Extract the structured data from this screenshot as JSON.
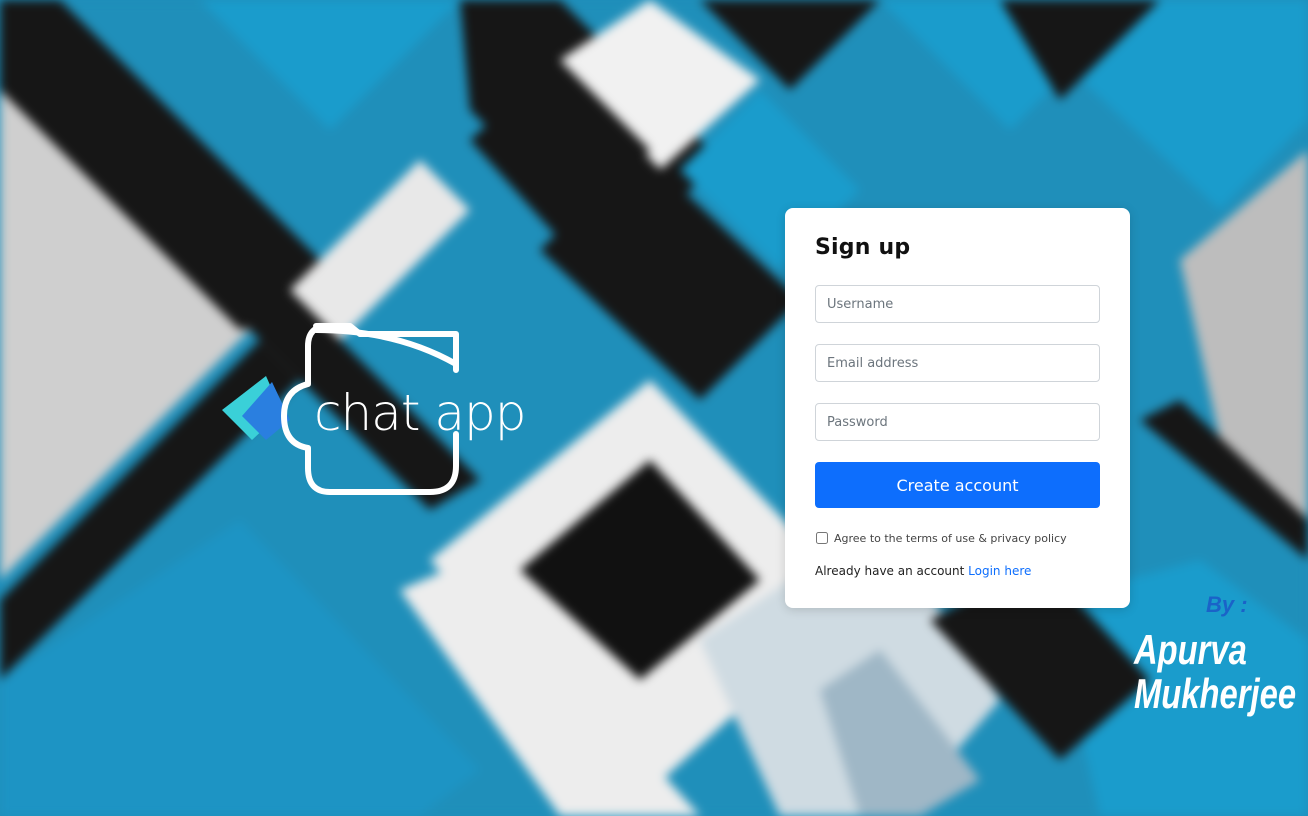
{
  "logo": {
    "text": "chat app",
    "icon": "chat-folder-icon"
  },
  "signup": {
    "title": "Sign up",
    "username_placeholder": "Username",
    "email_placeholder": "Email address",
    "password_placeholder": "Password",
    "submit_label": "Create account",
    "terms_label": "Agree to the terms of use & privacy policy",
    "terms_checked": false,
    "already_text": "Already have an account",
    "login_link": "Login here"
  },
  "credit": {
    "by": "By :",
    "name_line1": "Apurva",
    "name_line2": "Mukherjee"
  },
  "colors": {
    "primary": "#0d6efd",
    "background_blue": "#1f8fba",
    "credit_by": "#1a63c8"
  }
}
